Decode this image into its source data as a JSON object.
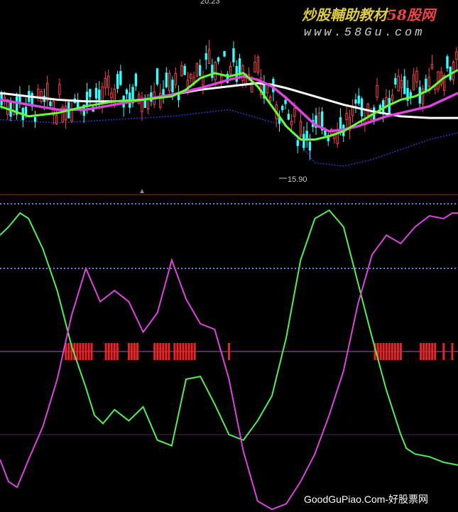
{
  "watermark": {
    "brand": "炒股輔助教材",
    "brand_accent": "58股网",
    "url": "www.58Gu.com",
    "footer": "GoodGuPiao.Com-好股票网"
  },
  "chart_data": [
    {
      "type": "candlestick",
      "panel": "price",
      "annotations": {
        "high_label": "20.23",
        "low_label": "15.90"
      },
      "x_range": [
        0,
        160
      ],
      "y_range": [
        14.9,
        20.5
      ],
      "grid": false,
      "colors": {
        "up": "#ff4444",
        "down": "#33ffff",
        "ma_short": "#66ff33",
        "ma_mid": "#dd44dd",
        "ma_long": "#ffffff",
        "band": "#3333cc"
      },
      "ma_short": {
        "x": [
          0,
          10,
          20,
          30,
          40,
          50,
          60,
          65,
          70,
          75,
          80,
          85,
          90,
          95,
          100,
          105,
          110,
          115,
          120,
          125,
          130,
          135,
          140,
          145,
          150,
          155,
          160
        ],
        "y": [
          17.3,
          17.0,
          17.1,
          17.3,
          17.45,
          17.5,
          17.6,
          17.8,
          18.15,
          18.3,
          18.2,
          18.3,
          17.9,
          17.3,
          16.7,
          16.3,
          16.3,
          16.4,
          16.55,
          16.8,
          17.05,
          17.3,
          17.5,
          17.6,
          17.8,
          18.15,
          18.4
        ]
      },
      "ma_mid": {
        "x": [
          0,
          10,
          20,
          30,
          40,
          50,
          60,
          70,
          80,
          85,
          90,
          95,
          100,
          105,
          110,
          115,
          120,
          125,
          130,
          135,
          140,
          145,
          150,
          155,
          160
        ],
        "y": [
          17.5,
          17.35,
          17.2,
          17.2,
          17.35,
          17.5,
          17.65,
          17.85,
          18.1,
          18.2,
          18.1,
          17.9,
          17.55,
          17.15,
          16.75,
          16.55,
          16.6,
          16.7,
          16.85,
          17.0,
          17.1,
          17.2,
          17.3,
          17.5,
          17.7
        ]
      },
      "ma_long": {
        "x": [
          0,
          10,
          20,
          30,
          40,
          50,
          60,
          70,
          80,
          90,
          95,
          100,
          110,
          120,
          130,
          140,
          150,
          160
        ],
        "y": [
          17.7,
          17.6,
          17.5,
          17.45,
          17.45,
          17.5,
          17.65,
          17.8,
          17.9,
          18.0,
          17.95,
          17.85,
          17.6,
          17.35,
          17.15,
          17.0,
          16.95,
          16.95
        ]
      },
      "lower_band": {
        "x": [
          0,
          20,
          40,
          60,
          80,
          100,
          110,
          120,
          130,
          140,
          150,
          160
        ],
        "y": [
          16.9,
          16.8,
          16.9,
          17.0,
          17.2,
          16.7,
          15.6,
          15.5,
          15.7,
          16.0,
          16.3,
          16.5
        ]
      }
    },
    {
      "type": "line",
      "panel": "oscillator",
      "x_range": [
        0,
        160
      ],
      "y_range": [
        0,
        100
      ],
      "grid": false,
      "levels": [
        80,
        50,
        20
      ],
      "series": [
        {
          "color": "#55ee55",
          "x": [
            0,
            3,
            7,
            10,
            15,
            20,
            25,
            30,
            33,
            36,
            40,
            45,
            50,
            55,
            60,
            65,
            70,
            75,
            80,
            85,
            90,
            95,
            100,
            105,
            110,
            115,
            120,
            125,
            130,
            135,
            140,
            142,
            145,
            150,
            155,
            160
          ],
          "y": [
            92,
            95,
            100,
            98,
            87,
            72,
            52,
            37,
            27,
            24,
            29,
            25,
            30,
            18,
            16,
            40,
            41,
            31,
            20,
            18,
            25,
            34,
            55,
            83,
            98,
            101,
            95,
            75,
            55,
            36,
            20,
            15,
            13,
            12,
            10,
            9
          ]
        },
        {
          "color": "#dd44dd",
          "x": [
            0,
            3,
            6,
            10,
            15,
            20,
            25,
            30,
            35,
            40,
            45,
            50,
            55,
            60,
            65,
            70,
            75,
            80,
            85,
            90,
            95,
            100,
            105,
            110,
            115,
            120,
            125,
            130,
            135,
            140,
            145,
            150,
            155,
            158,
            160
          ],
          "y": [
            11,
            3,
            1,
            11,
            23,
            40,
            63,
            80,
            68,
            72,
            68,
            57,
            64,
            83,
            69,
            60,
            58,
            40,
            14,
            -4,
            -7,
            -5,
            3,
            13,
            27,
            43,
            67,
            85,
            92,
            89,
            95,
            99,
            98,
            100,
            100
          ]
        }
      ],
      "signal_ticks": [
        23,
        24,
        25,
        26,
        27,
        28,
        29,
        30,
        31,
        32,
        37,
        38,
        39,
        40,
        41,
        45,
        46,
        47,
        48,
        54,
        55,
        56,
        57,
        58,
        59,
        61,
        62,
        63,
        64,
        65,
        66,
        67,
        68,
        80,
        131,
        132,
        133,
        134,
        135,
        136,
        137,
        138,
        139,
        140,
        147,
        148,
        149,
        150,
        151,
        152,
        155,
        158
      ]
    }
  ]
}
